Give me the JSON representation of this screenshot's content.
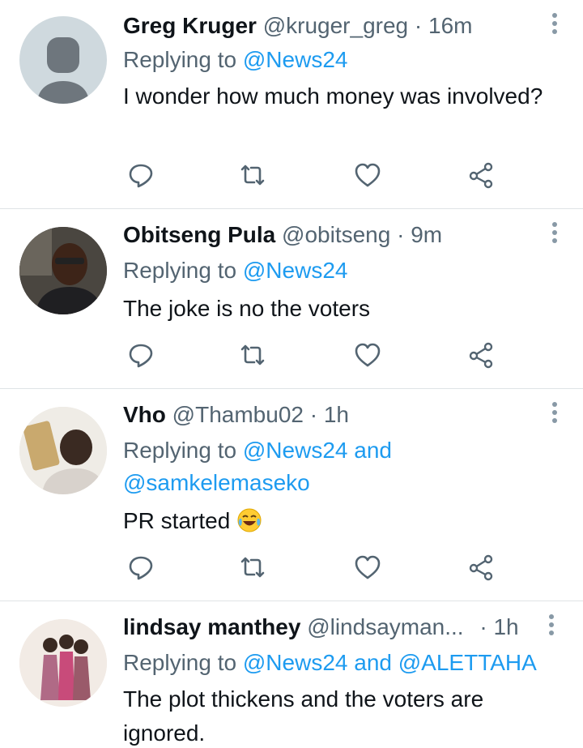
{
  "tweets": [
    {
      "name": "Greg Kruger",
      "handle": "@kruger_greg",
      "dot": "·",
      "time": "16m",
      "replying_prefix": "Replying to",
      "mention1": "@News24",
      "mention_joiner": "",
      "mention2": "",
      "text": "I wonder how much money was involved?",
      "avatar": "default-avatar-icon"
    },
    {
      "name": "Obitseng Pula",
      "handle": "@obitseng",
      "dot": "·",
      "time": "9m",
      "replying_prefix": "Replying to",
      "mention1": "@News24",
      "text": "The joke is no the voters",
      "avatar": "person-photo"
    },
    {
      "name": "Vho",
      "handle": "@Thambu02",
      "dot": "·",
      "time": "1h",
      "replying_prefix": "Replying to",
      "mention1": "@News24",
      "mention_joiner": "and",
      "mention2": "@samkelemaseko",
      "text": "PR started",
      "emoji": "tears-of-joy-emoji",
      "avatar": "child-photo"
    },
    {
      "name": "lindsay manthey",
      "handle": "@lindsayman...",
      "dot": "·",
      "time": "1h",
      "replying_prefix": "Replying to",
      "mention1": "@News24",
      "mention_joiner": "and",
      "mention2": "@ALETTAHA",
      "text": "The plot thickens and the voters are ignored.",
      "avatar": "group-photo"
    }
  ],
  "colors": {
    "link": "#1d9bf0",
    "secondary": "#536471",
    "divider": "#dfe3e6"
  }
}
